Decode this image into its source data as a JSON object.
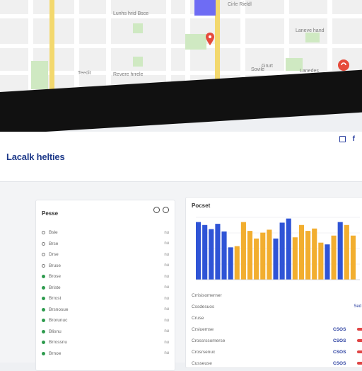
{
  "map": {
    "labels": [
      "Cirle Rieldl",
      "Lunhs hrid Bsce",
      "Revere hrrele",
      "Laneve hand",
      "Grurt",
      "Teedit",
      "Sovile",
      "Lanedes"
    ],
    "pin_color": "#e64a3b"
  },
  "header": {
    "brand": "Lacalk helties",
    "icons": [
      "square-icon",
      "facebook-icon"
    ]
  },
  "left_panel": {
    "title": "Pesse",
    "items": [
      {
        "label": "Bsle",
        "value": "nu",
        "status": "outline"
      },
      {
        "label": "Brse",
        "value": "nu",
        "status": "outline"
      },
      {
        "label": "Drse",
        "value": "nu",
        "status": "outline"
      },
      {
        "label": "Bruse",
        "value": "nu",
        "status": "outline"
      },
      {
        "label": "Brose",
        "value": "nu",
        "status": "green"
      },
      {
        "label": "Briste",
        "value": "nu",
        "status": "green"
      },
      {
        "label": "Brrost",
        "value": "nu",
        "status": "green"
      },
      {
        "label": "Brsnosue",
        "value": "nu",
        "status": "green"
      },
      {
        "label": "Brorunuc",
        "value": "nu",
        "status": "green"
      },
      {
        "label": "Blisnu",
        "value": "nu",
        "status": "green"
      },
      {
        "label": "Brrossnu",
        "value": "nu",
        "status": "green"
      },
      {
        "label": "Brnoe",
        "value": "nu",
        "status": "green"
      }
    ]
  },
  "chart_panel": {
    "title": "Pocset"
  },
  "chart_data": {
    "type": "bar",
    "title": "Pocset",
    "xlabel": "",
    "ylabel": "",
    "ylim": [
      0,
      100
    ],
    "grid": true,
    "colors": [
      "#2f54d6",
      "#f2ae2f"
    ],
    "values": [
      98,
      93,
      86,
      95,
      82,
      55,
      57,
      98,
      83,
      70,
      80,
      85,
      70,
      97,
      104,
      72,
      93,
      83,
      87,
      63,
      60,
      75,
      98,
      93,
      75
    ],
    "bar_colors": [
      0,
      0,
      0,
      0,
      0,
      0,
      1,
      1,
      1,
      1,
      1,
      1,
      0,
      0,
      0,
      1,
      1,
      1,
      1,
      1,
      0,
      1,
      0,
      1,
      1
    ]
  },
  "table": {
    "rows": [
      {
        "label": "Crrisisomerner",
        "code": "",
        "edge": ""
      },
      {
        "label": "Cssdesuos",
        "code": "",
        "edge": "Sed"
      },
      {
        "label": "Cruse",
        "code": "",
        "edge": ""
      },
      {
        "label": "Crsiuemse",
        "code": "CSOS",
        "edge": ""
      },
      {
        "label": "Crossrssomerse",
        "code": "CSOS",
        "edge": ""
      },
      {
        "label": "Crosrsenuc",
        "code": "CSOS",
        "edge": ""
      },
      {
        "label": "Cusseuse",
        "code": "CSOS",
        "edge": ""
      }
    ]
  }
}
